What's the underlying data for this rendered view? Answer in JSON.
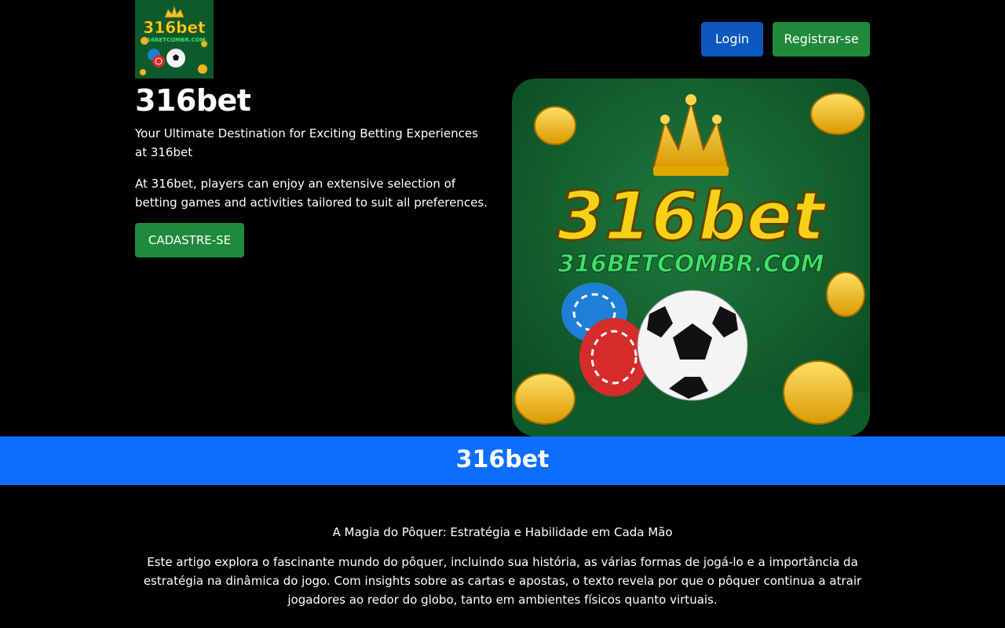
{
  "header": {
    "logo_wordmark": "316bet",
    "logo_domain": "316BETCOMBR.COM",
    "login_label": "Login",
    "register_label": "Registrar-se"
  },
  "hero": {
    "title": "316bet",
    "subtitle": "Your Ultimate Destination for Exciting Betting Experiences at 316bet",
    "description": "At 316bet, players can enjoy an extensive selection of betting games and activities tailored to suit all preferences.",
    "cta_label": "CADASTRE-SE",
    "image_wordmark": "316bet",
    "image_domain": "316BETCOMBR.COM"
  },
  "band": {
    "title": "316bet"
  },
  "article": {
    "title": "A Magia do Pôquer: Estratégia e Habilidade em Cada Mão",
    "body": "Este artigo explora o fascinante mundo do pôquer, incluindo sua história, as várias formas de jogá-lo e a importância da estratégia na dinâmica do jogo. Com insights sobre as cartas e apostas, o texto revela por que o pôquer continua a atrair jogadores ao redor do globo, tanto em ambientes físicos quanto virtuais."
  },
  "colors": {
    "background": "#000000",
    "login_button": "#0d58bf",
    "register_button": "#1f8a3b",
    "band": "#0d6efd",
    "logo_green": "#0d5a2c",
    "brand_yellow": "#f7d117"
  }
}
